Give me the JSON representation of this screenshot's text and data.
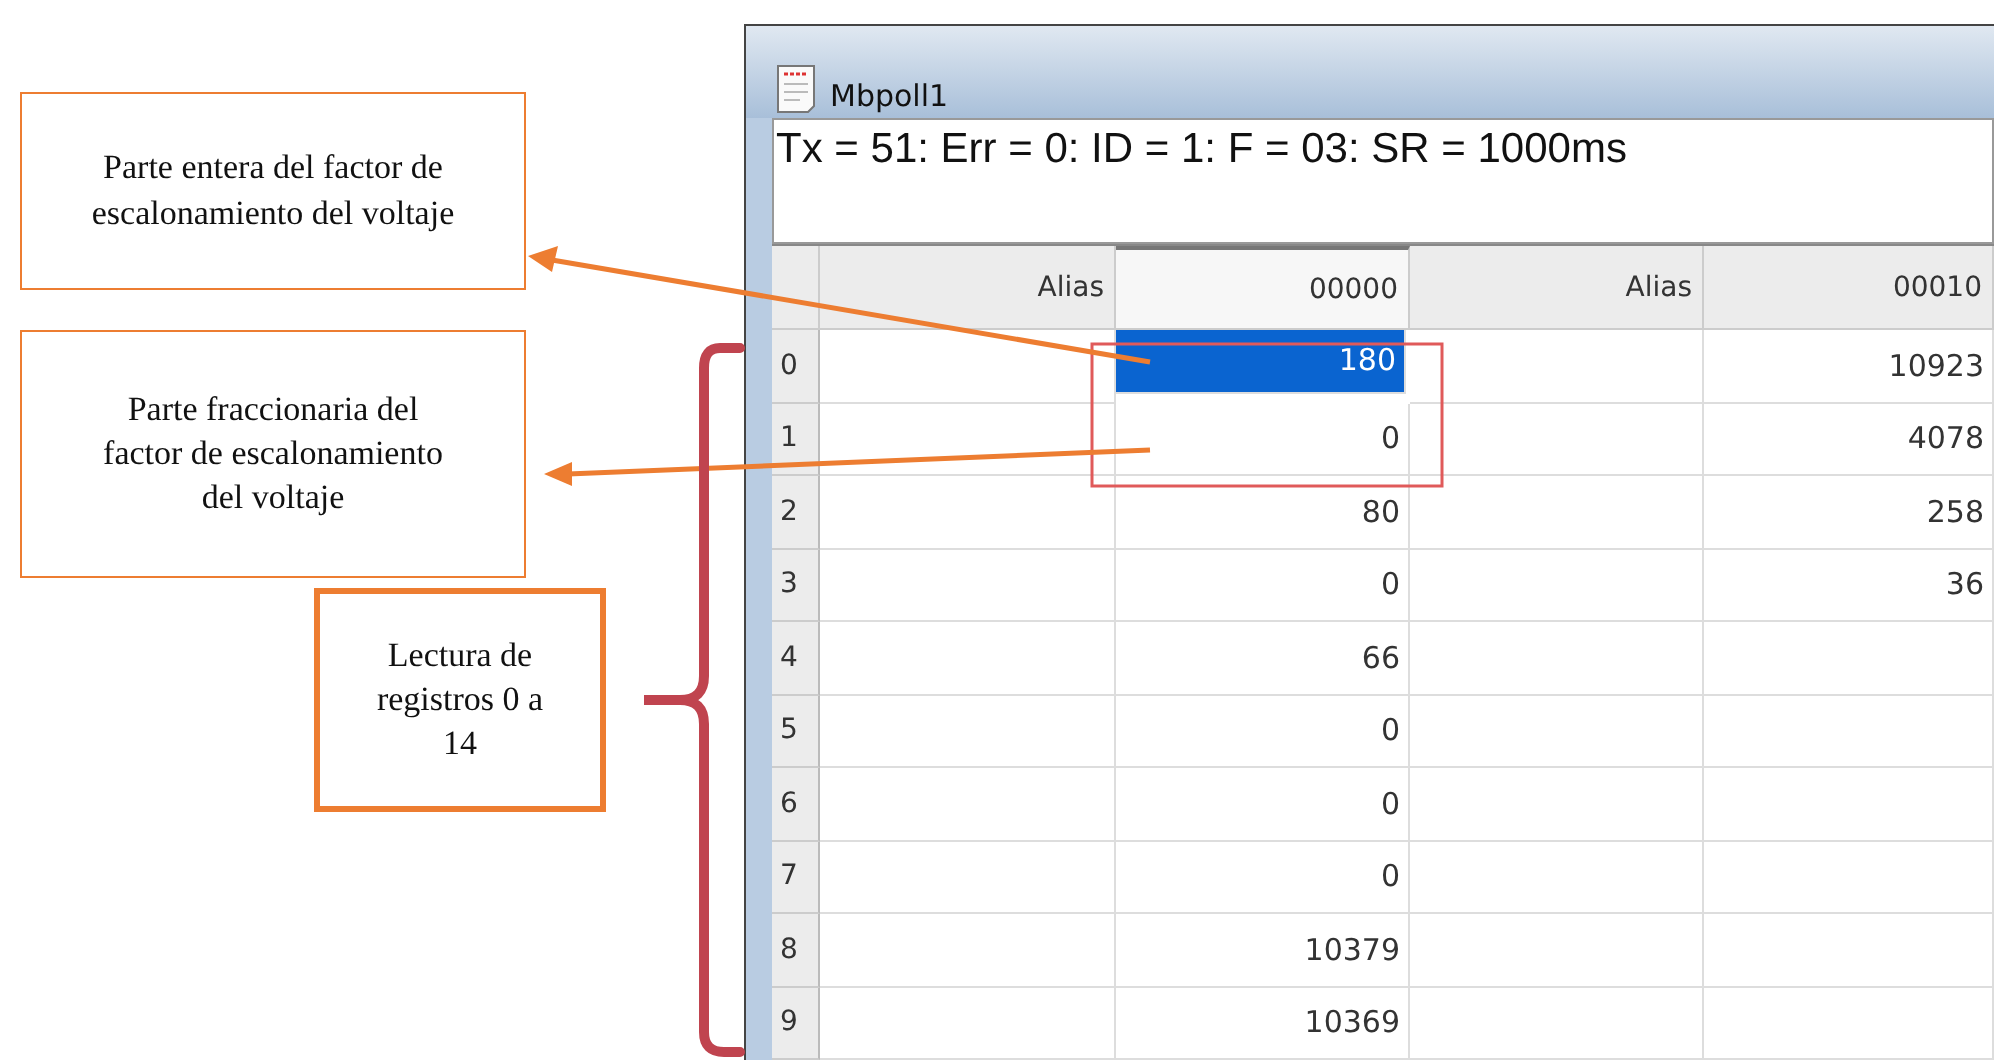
{
  "window": {
    "title": "Mbpoll1"
  },
  "status_line": "Tx = 51: Err = 0: ID = 1: F = 03: SR = 1000ms",
  "table": {
    "columns": [
      "Alias",
      "00000",
      "Alias",
      "00010"
    ],
    "rows": [
      {
        "label": "0",
        "first": {
          "text": "180",
          "selected": true
        },
        "second": {
          "text": "10923",
          "selected": false
        }
      },
      {
        "label": "1",
        "first": {
          "text": "0",
          "selected": false
        },
        "second": {
          "text": "4078",
          "selected": false
        }
      },
      {
        "label": "2",
        "first": {
          "text": "80",
          "selected": false
        },
        "second": {
          "text": "258",
          "selected": false
        }
      },
      {
        "label": "3",
        "first": {
          "text": "0",
          "selected": false
        },
        "second": {
          "text": "36",
          "selected": false
        }
      },
      {
        "label": "4",
        "first": {
          "text": "66",
          "selected": false
        }
      },
      {
        "label": "5",
        "first": {
          "text": "0",
          "selected": false
        }
      },
      {
        "label": "6",
        "first": {
          "text": "0",
          "selected": false
        }
      },
      {
        "label": "7",
        "first": {
          "text": "0",
          "selected": false
        }
      },
      {
        "label": "8",
        "first": {
          "text": "10379",
          "selected": false
        }
      },
      {
        "label": "9",
        "first": {
          "text": "10369",
          "selected": false
        }
      }
    ]
  },
  "annotations": [
    {
      "text": "Parte entera del factor de escalonamiento del voltaje"
    },
    {
      "text": "Parte fraccionaria del factor de escalonamiento del voltaje"
    },
    {
      "text": "Lectura de registros 0 a 14"
    }
  ]
}
